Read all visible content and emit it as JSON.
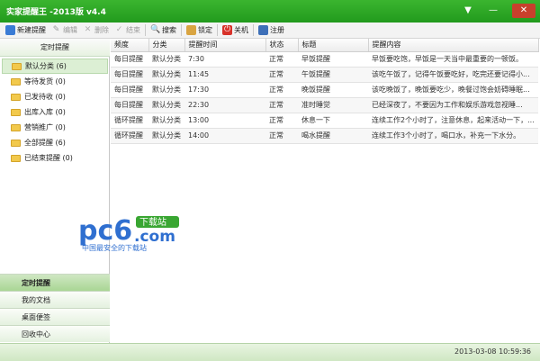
{
  "window": {
    "title": "实家提醒王 -2013版 v4.4"
  },
  "toolbar": {
    "items": [
      {
        "label": "新建提醒",
        "icon": "new-reminder-icon",
        "enabled": true
      },
      {
        "label": "编辑",
        "icon": "edit-icon",
        "enabled": false
      },
      {
        "label": "删除",
        "icon": "delete-icon",
        "enabled": false
      },
      {
        "label": "结束",
        "icon": "end-icon",
        "enabled": false
      },
      {
        "label": "搜索",
        "icon": "search-icon",
        "enabled": true
      },
      {
        "label": "锁定",
        "icon": "lock-icon",
        "enabled": true
      },
      {
        "label": "关机",
        "icon": "power-icon",
        "enabled": true
      },
      {
        "label": "注册",
        "icon": "register-icon",
        "enabled": true
      }
    ]
  },
  "sidebar": {
    "header": "定时提醒",
    "folders": [
      {
        "label": "默认分类 (6)",
        "selected": true
      },
      {
        "label": "等待发货 (0)",
        "selected": false
      },
      {
        "label": "已发待收 (0)",
        "selected": false
      },
      {
        "label": "出库入库 (0)",
        "selected": false
      },
      {
        "label": "营销推广 (0)",
        "selected": false
      },
      {
        "label": "全部提醒 (6)",
        "selected": false
      },
      {
        "label": "已结束提醒 (0)",
        "selected": false
      }
    ],
    "nav": [
      {
        "label": "定时提醒",
        "active": true
      },
      {
        "label": "我的文档",
        "active": false
      },
      {
        "label": "桌面便签",
        "active": false
      },
      {
        "label": "回收中心",
        "active": false
      }
    ]
  },
  "table": {
    "columns": [
      "频度",
      "分类",
      "提醒时间",
      "状态",
      "标题",
      "提醒内容"
    ],
    "rows": [
      [
        "每日提醒",
        "默认分类",
        "7:30",
        "正常",
        "早饭提醒",
        "早饭要吃饱，早饭是一天当中最重要的一顿饭。"
      ],
      [
        "每日提醒",
        "默认分类",
        "11:45",
        "正常",
        "午饭提醒",
        "该吃午饭了，记得午饭要吃好，吃完还要记得小..."
      ],
      [
        "每日提醒",
        "默认分类",
        "17:30",
        "正常",
        "晚饭提醒",
        "该吃晚饭了，晚饭要吃少，晚餐过饱会妨碍睡眠..."
      ],
      [
        "每日提醒",
        "默认分类",
        "22:30",
        "正常",
        "准时睡觉",
        "已经深夜了，不要因为工作和娱乐游戏忽视睡..."
      ],
      [
        "循环提醒",
        "默认分类",
        "13:00",
        "正常",
        "休息一下",
        "连续工作2个小时了，注意休息，起来活动一下，..."
      ],
      [
        "循环提醒",
        "默认分类",
        "14:00",
        "正常",
        "喝水提醒",
        "连续工作3个小时了，喝口水，补充一下水分。"
      ]
    ]
  },
  "watermark": {
    "brand": "pc6",
    "domain": ".com",
    "badge": "下载站",
    "tagline": "中国最安全的下载站"
  },
  "statusbar": {
    "datetime": "2013-03-08  10:59:36"
  },
  "colors": {
    "accent": "#2ea626",
    "title_bar": "#229a1d",
    "close_button": "#c8402c",
    "selection": "#dcefd4"
  }
}
